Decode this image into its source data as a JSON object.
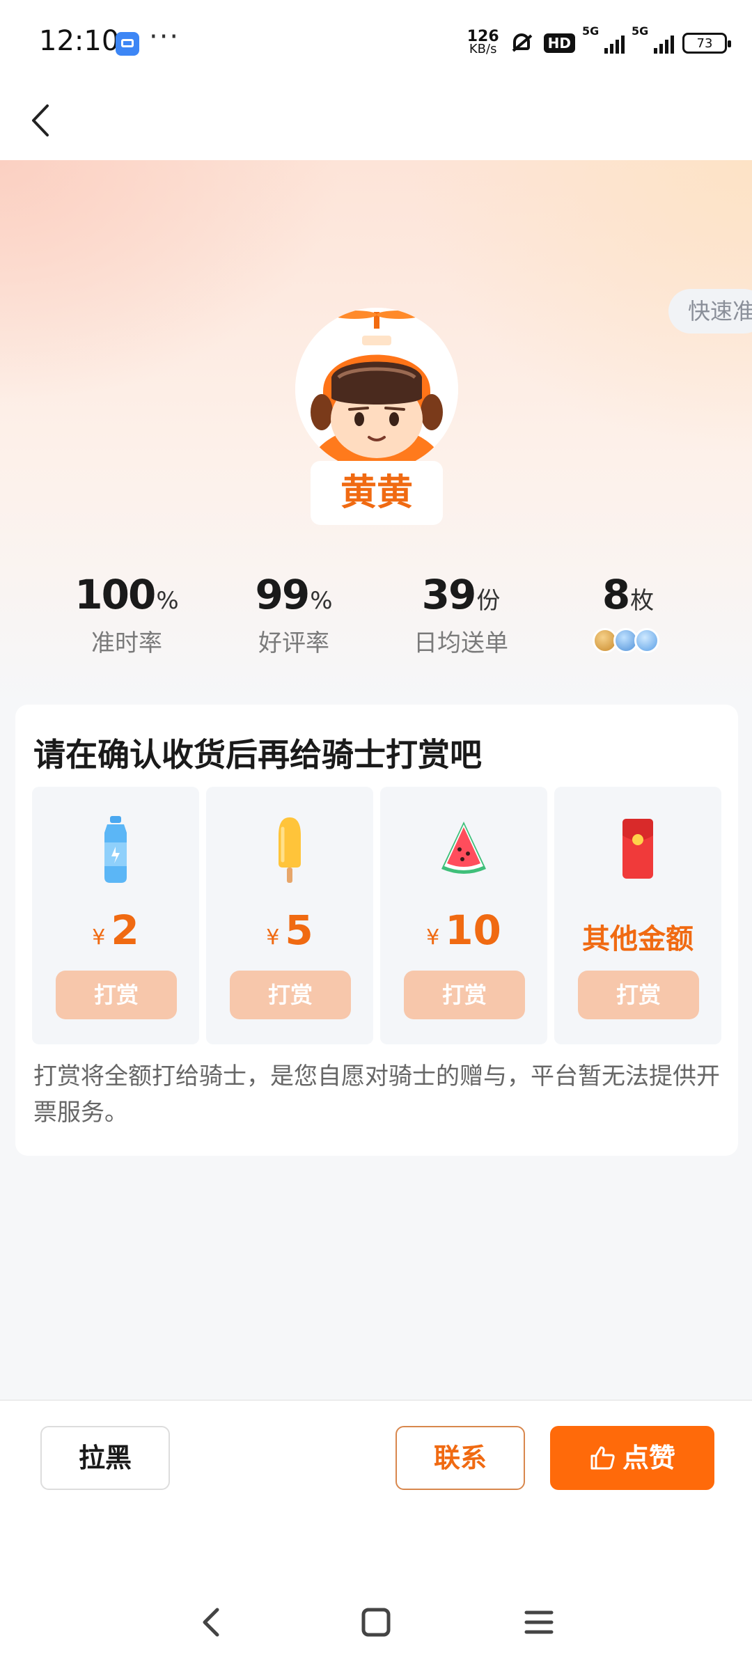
{
  "status_bar": {
    "time": "12:10",
    "more": "···",
    "net_speed_value": "126",
    "net_speed_unit": "KB/s",
    "hd_badge": "HD",
    "signal1_label": "5G",
    "signal2_label": "5G",
    "battery": "73"
  },
  "header": {
    "back_icon": "chevron-left-icon"
  },
  "rider": {
    "name": "黄黄",
    "quick_pill": "快速准"
  },
  "stats": [
    {
      "value": "100",
      "unit": "%",
      "label": "准时率"
    },
    {
      "value": "99",
      "unit": "%",
      "label": "好评率"
    },
    {
      "value": "39",
      "unit": "份",
      "label": "日均送单"
    },
    {
      "value": "8",
      "unit": "枚",
      "label": ""
    }
  ],
  "tip_card": {
    "title": "请在确认收货后再给骑士打赏吧",
    "currency": "¥",
    "options": [
      {
        "amount": "2",
        "button": "打赏",
        "icon": "water-bottle-icon"
      },
      {
        "amount": "5",
        "button": "打赏",
        "icon": "popsicle-icon"
      },
      {
        "amount": "10",
        "button": "打赏",
        "icon": "watermelon-icon"
      },
      {
        "amount": "其他金额",
        "button": "打赏",
        "icon": "red-envelope-icon"
      }
    ],
    "note": "打赏将全额打给骑士，是您自愿对骑士的赠与，平台暂无法提供开票服务。"
  },
  "actions": {
    "block": "拉黑",
    "contact": "联系",
    "like": "点赞"
  },
  "colors": {
    "accent": "#ff6a0a",
    "accent_text": "#f06a12",
    "tip_button": "#f7c7ab"
  }
}
